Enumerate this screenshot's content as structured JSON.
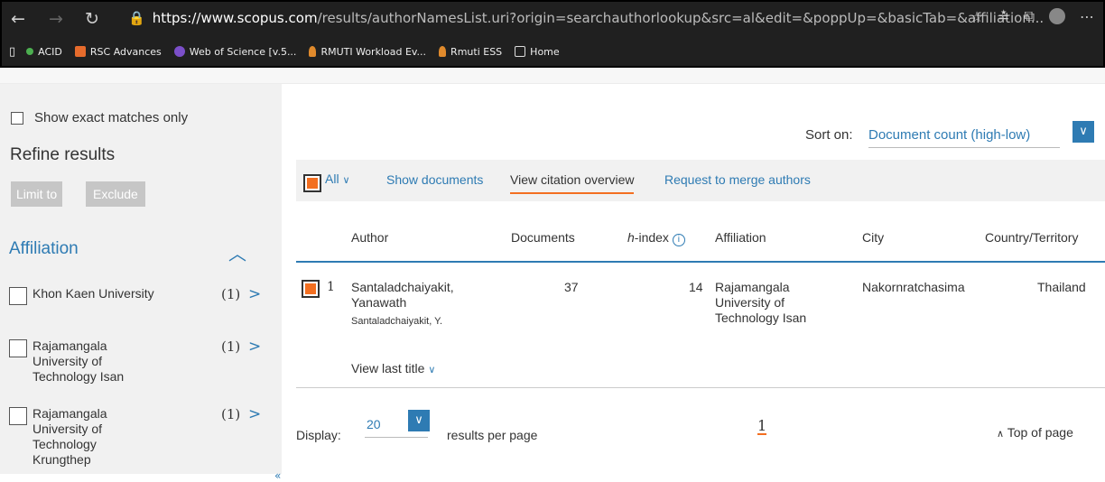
{
  "browser": {
    "back_icon": "←",
    "forward_icon": "→",
    "refresh_icon": "↻",
    "url_prefix": "https://",
    "url_domain": "www.scopus.com",
    "url_rest": "/results/authorNamesList.uri?origin=searchauthorlookup&src=al&edit=&poppUp=&basicTab=&affiliation...",
    "bookmarks": [
      {
        "label": "ACID",
        "color": "#4caf50"
      },
      {
        "label": "RSC Advances",
        "color": "#e66b2c"
      },
      {
        "label": "Web of Science [v.5...",
        "color": "#7b4fc9"
      },
      {
        "label": "RMUTI Workload Ev...",
        "color": "#e08a2c"
      },
      {
        "label": "Rmuti ESS",
        "color": "#e08a2c"
      },
      {
        "label": "Home",
        "color": "#dddddd"
      }
    ]
  },
  "sidebar": {
    "exact_label": "Show exact matches only",
    "refine_title": "Refine results",
    "limit_label": "Limit to",
    "exclude_label": "Exclude",
    "affiliation_title": "Affiliation",
    "facets": [
      {
        "label": "Khon Kaen University",
        "count": "(1)"
      },
      {
        "label": "Rajamangala University of Technology Isan",
        "count": "(1)"
      },
      {
        "label": "Rajamangala University of Technology Krungthep",
        "count": "(1)"
      }
    ],
    "collapse_icon": "«"
  },
  "main": {
    "sort_label": "Sort on:",
    "sort_value": "Document count (high-low)",
    "actions": {
      "all_label": "All",
      "show_docs": "Show documents",
      "view_citation": "View citation overview",
      "merge": "Request to merge authors"
    },
    "columns": {
      "author": "Author",
      "documents": "Documents",
      "h_index_prefix": "h",
      "h_index_suffix": "-index",
      "affiliation": "Affiliation",
      "city": "City",
      "country": "Country/Territory"
    },
    "row": {
      "num": "1",
      "name_line1": "Santaladchaiyakit,",
      "name_line2": "Yanawath",
      "name_variant": "Santaladchaiyakit, Y.",
      "documents": "37",
      "h_index": "14",
      "affiliation": "Rajamangala University of Technology Isan",
      "city": "Nakornratchasima",
      "country": "Thailand",
      "view_last": "View last title"
    },
    "display_label": "Display:",
    "display_value": "20",
    "rpp_label": "results per page",
    "page": "1",
    "top_label": "Top of page"
  },
  "colors": {
    "accent": "#2e7bb3",
    "orange": "#f36f21"
  }
}
